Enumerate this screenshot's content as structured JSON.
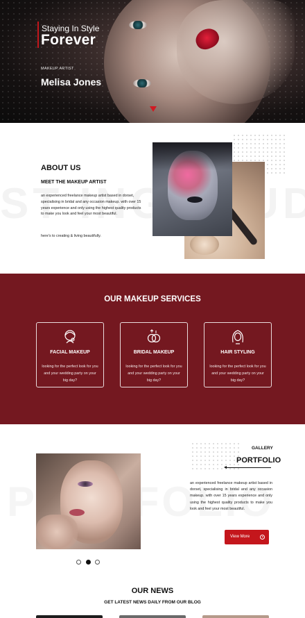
{
  "hero": {
    "title_line1": "Staying In Style",
    "title_line2": "Forever",
    "subtitle": "MAKEUP ARTIST",
    "name": "Melisa Jones"
  },
  "about": {
    "background_text": "ST ING STUDIO",
    "title": "ABOUT US",
    "subtitle": "MEET THE MAKEUP ARTIST",
    "body": "an experienced freelance makeup artist based in dorset, specialising in bridal and any occasion makeup. with over 15 years experience and only using the highest quality products to make you look and feel your most beautiful.",
    "footer": "here's to creating & living beautifully."
  },
  "services": {
    "title": "OUR MAKEUP SERVICES",
    "items": [
      {
        "icon": "face-makeup-icon",
        "title": "FACIAL MAKEUP",
        "text": "looking for the perfect look for you and your wedding party on your big day?"
      },
      {
        "icon": "wedding-rings-icon",
        "title": "BRIDAL MAKEUP",
        "text": "looking for the perfect look for you and your wedding party on your big day?"
      },
      {
        "icon": "hair-styling-icon",
        "title": "HAIR STYLING",
        "text": "looking for the perfect look for you and your wedding party on your big day?"
      }
    ]
  },
  "portfolio": {
    "background_text": "PORTFOLIO",
    "gallery_label": "GALLERY",
    "title": "PORTFOLIO",
    "body": "an experienced freelance makeup artist based in dorset, specialising in bridal and any occasion makeup. with over 15 years experience and only using the highest quality products to make you look and feel your most beautiful.",
    "button_label": "View More",
    "slider_count": 3,
    "slider_active": 2
  },
  "news": {
    "title": "OUR NEWS",
    "subtitle": "GET LATEST NEWS DAILY FROM OUR BLOG"
  },
  "colors": {
    "accent": "#c4161c",
    "services_bg": "#741820",
    "dark": "#111111"
  }
}
